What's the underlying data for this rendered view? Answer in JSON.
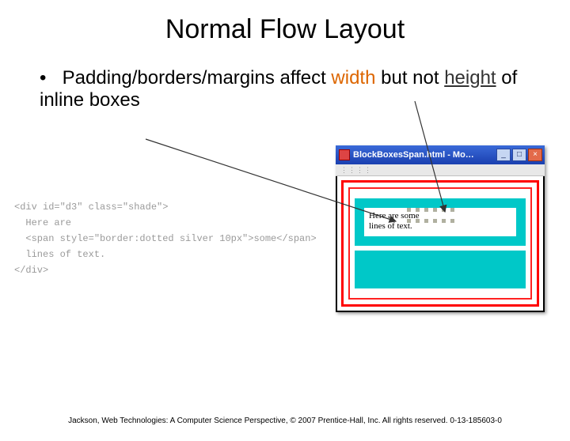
{
  "title": "Normal Flow Layout",
  "bullet": {
    "prefix": "Padding/borders/margins affect ",
    "width_word": "width",
    "middle": " but not ",
    "height_word": "height",
    "suffix": " of inline boxes"
  },
  "code": {
    "l1": "<div id=\"d3\" class=\"shade\">",
    "l2": "  Here are",
    "l3": "  <span style=\"border:dotted silver 10px\">some</span>",
    "l4": "  lines of text.",
    "l5": "</div>"
  },
  "browser": {
    "title": "BlockBoxesSpan.html - Mo…",
    "min": "_",
    "max": "□",
    "close": "×",
    "content": {
      "line1": "Here are   some",
      "line2": "lines of text."
    }
  },
  "footer": "Jackson, Web Technologies: A Computer Science Perspective, © 2007 Prentice-Hall, Inc. All rights reserved. 0-13-185603-0"
}
